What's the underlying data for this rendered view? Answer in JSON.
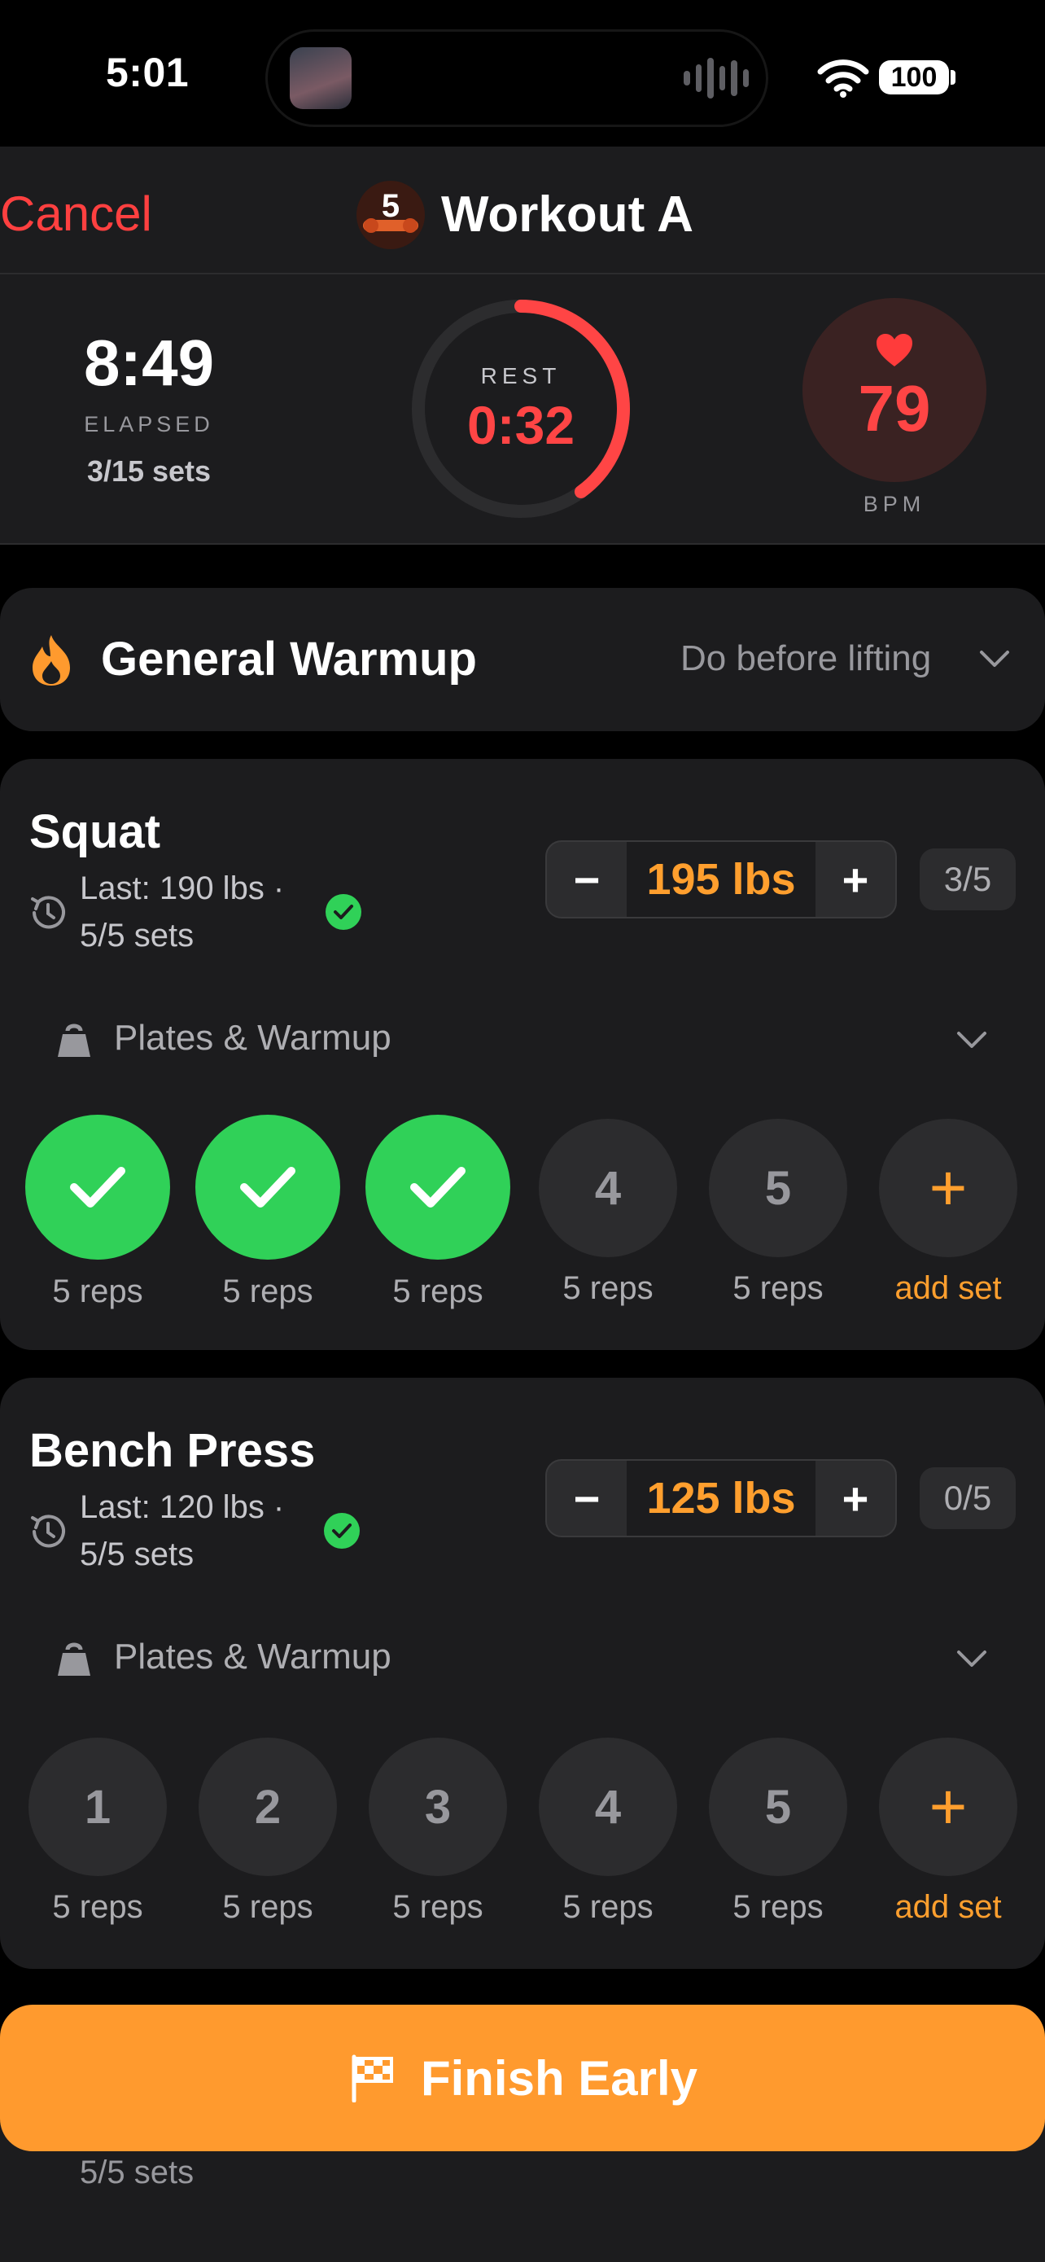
{
  "status_bar": {
    "time": "5:01",
    "battery": "100"
  },
  "nav": {
    "cancel": "Cancel",
    "logo_number": "5",
    "title": "Workout A"
  },
  "stats": {
    "elapsed": "8:49",
    "elapsed_label": "ELAPSED",
    "sets": "3/15 sets",
    "rest_label": "REST",
    "rest_value": "0:32",
    "rest_progress": 0.4,
    "bpm": "79",
    "bpm_label": "BPM"
  },
  "warmup": {
    "title": "General Warmup",
    "subtitle": "Do before lifting"
  },
  "exercises": [
    {
      "name": "Squat",
      "last_line1": "Last: 190 lbs ·",
      "last_line2": "5/5 sets",
      "weight": "195 lbs",
      "minus": "−",
      "plus": "+",
      "progress": "3/5",
      "plates_label": "Plates & Warmup",
      "sets": [
        {
          "label": "✓",
          "reps": "5 reps",
          "done": true
        },
        {
          "label": "✓",
          "reps": "5 reps",
          "done": true
        },
        {
          "label": "✓",
          "reps": "5 reps",
          "done": true
        },
        {
          "label": "4",
          "reps": "5 reps",
          "done": false
        },
        {
          "label": "5",
          "reps": "5 reps",
          "done": false
        }
      ],
      "add_set_icon": "+",
      "add_set": "add set"
    },
    {
      "name": "Bench Press",
      "last_line1": "Last: 120 lbs ·",
      "last_line2": "5/5 sets",
      "weight": "125 lbs",
      "minus": "−",
      "plus": "+",
      "progress": "0/5",
      "plates_label": "Plates & Warmup",
      "sets": [
        {
          "label": "1",
          "reps": "5 reps",
          "done": false
        },
        {
          "label": "2",
          "reps": "5 reps",
          "done": false
        },
        {
          "label": "3",
          "reps": "5 reps",
          "done": false
        },
        {
          "label": "4",
          "reps": "5 reps",
          "done": false
        },
        {
          "label": "5",
          "reps": "5 reps",
          "done": false
        }
      ],
      "add_set_icon": "+",
      "add_set": "add set"
    }
  ],
  "finish": {
    "label": "Finish Early"
  },
  "behind": {
    "text": "5/5 sets"
  },
  "colors": {
    "accent": "#ff9a2e",
    "danger": "#ff4545",
    "success": "#30d158",
    "card": "#1c1c1e"
  },
  "icons": [
    "wifi-icon",
    "heart-icon",
    "flame-icon",
    "history-icon",
    "kettlebell-icon",
    "chevron-down-icon",
    "checkmark-icon",
    "flag-icon",
    "waveform-icon"
  ]
}
